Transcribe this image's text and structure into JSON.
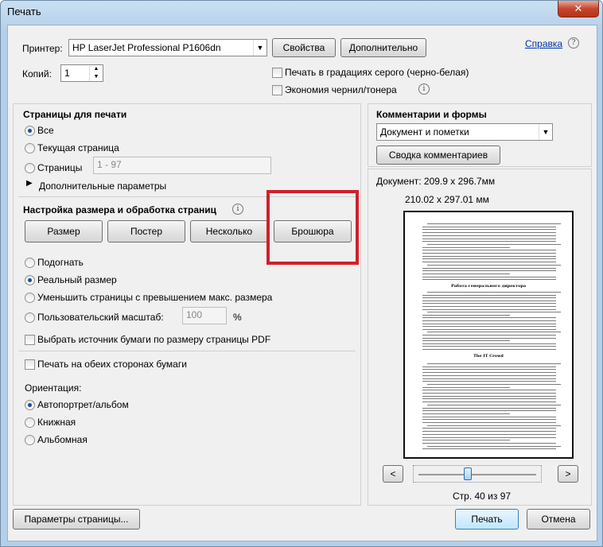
{
  "window": {
    "title": "Печать",
    "close_glyph": "✕"
  },
  "printer": {
    "label": "Принтер:",
    "value": "HP LaserJet Professional P1606dn",
    "properties_btn": "Свойства",
    "advanced_btn": "Дополнительно",
    "help_link": "Справка",
    "help_icon": "?"
  },
  "copies": {
    "label": "Копий:",
    "value": "1"
  },
  "options": {
    "grayscale": "Печать в градациях серого (черно-белая)",
    "save_ink": "Экономия чернил/тонера"
  },
  "pages": {
    "heading": "Страницы для печати",
    "all": "Все",
    "current": "Текущая страница",
    "range": "Страницы",
    "range_value": "1 - 97",
    "more_options": "Дополнительные параметры"
  },
  "sizing": {
    "heading": "Настройка размера и обработка страниц",
    "tabs": [
      "Размер",
      "Постер",
      "Несколько",
      "Брошюра"
    ],
    "fit": "Подогнать",
    "actual": "Реальный размер",
    "shrink": "Уменьшить страницы с превышением макс. размера",
    "custom": "Пользовательский масштаб:",
    "custom_value": "100",
    "percent": "%",
    "paper_source": "Выбрать источник бумаги по размеру страницы PDF"
  },
  "duplex": "Печать на обеих сторонах бумаги",
  "orientation": {
    "heading": "Ориентация:",
    "auto": "Автопортрет/альбом",
    "portrait": "Книжная",
    "landscape": "Альбомная"
  },
  "comments": {
    "heading": "Комментарии и формы",
    "value": "Документ и пометки",
    "summary_btn": "Сводка комментариев"
  },
  "preview": {
    "document_size": "Документ: 209.9 x 296.7мм",
    "paper_size": "210.02 x 297.01 мм",
    "heading1": "Работа генерального директора",
    "heading2": "The IT Crowd",
    "prev": "<",
    "next": ">",
    "page_info": "Стр. 40 из 97",
    "page_progress": 0.41
  },
  "footer": {
    "page_setup": "Параметры страницы...",
    "print": "Печать",
    "cancel": "Отмена"
  },
  "highlight_color": "#d0202a"
}
